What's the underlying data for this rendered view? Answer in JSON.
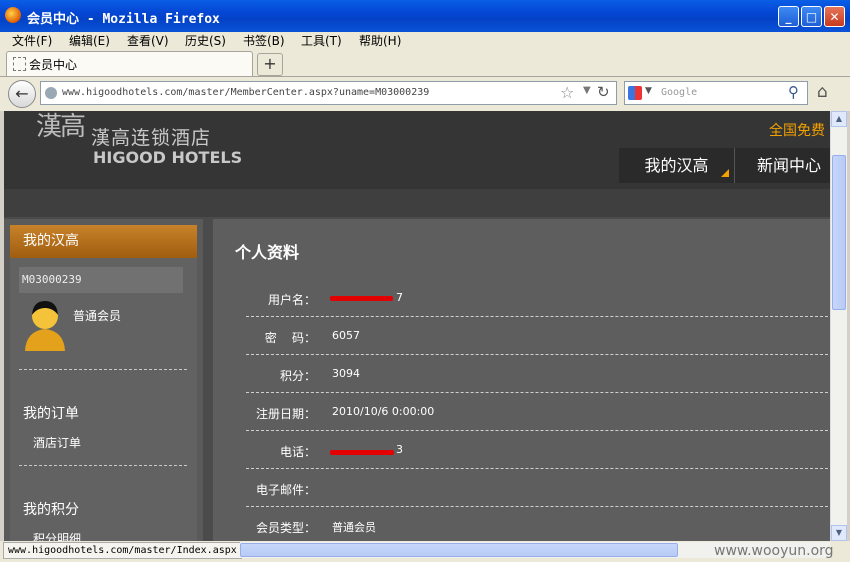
{
  "window": {
    "title": "会员中心 - Mozilla Firefox",
    "minimize": "_",
    "maximize": "□",
    "close": "✕"
  },
  "menu": [
    "文件(F)",
    "编辑(E)",
    "查看(V)",
    "历史(S)",
    "书签(B)",
    "工具(T)",
    "帮助(H)"
  ],
  "tab": {
    "label": "会员中心",
    "new_tab": "+"
  },
  "nav": {
    "url": "www.higoodhotels.com/master/MemberCenter.aspx?uname=M03000239",
    "search_placeholder": "Google"
  },
  "site": {
    "logo_mark": "漢高",
    "logo_cn": "漢高连锁酒店",
    "logo_en": "HIGOOD HOTELS",
    "hotline": "全国免费",
    "nav": [
      "我的汉高",
      "新闻中心"
    ]
  },
  "sidebar": {
    "header": "我的汉高",
    "member_id": "M03000239",
    "member_level": "普通会员",
    "sections": [
      {
        "title": "我的订单",
        "link": "酒店订单"
      },
      {
        "title": "我的积分",
        "link": "积分明细"
      }
    ]
  },
  "profile": {
    "title": "个人资料",
    "rows": [
      {
        "label": "用户名：",
        "value": "7",
        "redacted": true
      },
      {
        "label": "密    码：",
        "value": "6057"
      },
      {
        "label": "积分：",
        "value": "3094"
      },
      {
        "label": "注册日期：",
        "value": "2010/10/6 0:00:00"
      },
      {
        "label": "电话：",
        "value": "3",
        "redacted": true
      },
      {
        "label": "电子邮件：",
        "value": ""
      },
      {
        "label": "会员类型：",
        "value": "普通会员"
      }
    ]
  },
  "status": {
    "text": "www.higoodhotels.com/master/Index.aspx",
    "watermark": "www.wooyun.org"
  },
  "colors": {
    "accent_orange": "#f3a100",
    "redaction": "#e30000",
    "page_bg": "#4b4b4b"
  }
}
